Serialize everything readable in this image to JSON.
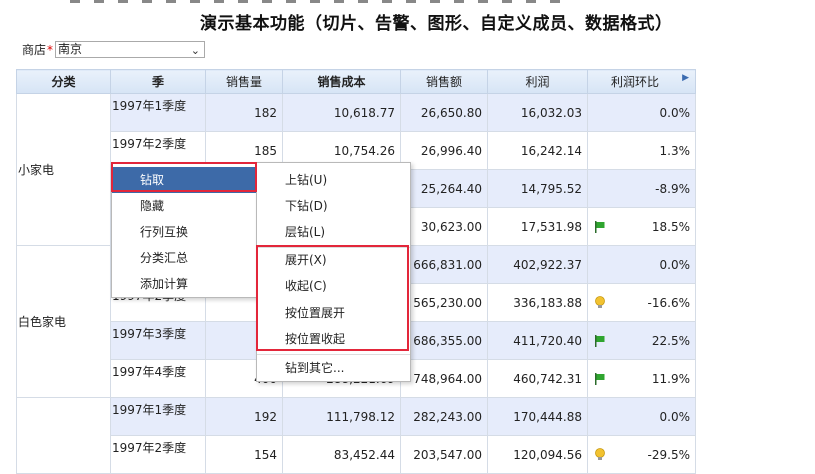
{
  "page": {
    "title": "演示基本功能（切片、告警、图形、自定义成员、数据格式）"
  },
  "filter": {
    "label": "商店",
    "required_mark": "*",
    "value": "南京"
  },
  "table": {
    "headers": [
      "分类",
      "季",
      "销售量",
      "销售成本",
      "销售额",
      "利润",
      "利润环比"
    ],
    "rows": [
      {
        "quarter": "1997年1季度",
        "sales_qty": "182",
        "cost": "10,618.77",
        "revenue": "26,650.80",
        "profit": "16,032.03",
        "ratio": "0.0%",
        "icon": ""
      },
      {
        "quarter": "1997年2季度",
        "sales_qty": "185",
        "cost": "10,754.26",
        "revenue": "26,996.40",
        "profit": "16,242.14",
        "ratio": "1.3%",
        "icon": ""
      },
      {
        "quarter": "",
        "sales_qty": "",
        "cost": "",
        "revenue": "25,264.40",
        "profit": "14,795.52",
        "ratio": "-8.9%",
        "icon": ""
      },
      {
        "quarter": "",
        "sales_qty": "",
        "cost": "",
        "revenue": "30,623.00",
        "profit": "17,531.98",
        "ratio": "18.5%",
        "icon": "flag"
      },
      {
        "quarter": "",
        "sales_qty": "",
        "cost": "",
        "revenue": "666,831.00",
        "profit": "402,922.37",
        "ratio": "0.0%",
        "icon": ""
      },
      {
        "quarter": "1997年2季度",
        "sales_qty": "",
        "cost": "",
        "revenue": "565,230.00",
        "profit": "336,183.88",
        "ratio": "-16.6%",
        "icon": "bulb"
      },
      {
        "quarter": "1997年3季度",
        "sales_qty": "",
        "cost": "",
        "revenue": "686,355.00",
        "profit": "411,720.40",
        "ratio": "22.5%",
        "icon": "flag"
      },
      {
        "quarter": "1997年4季度",
        "sales_qty": "400",
        "cost": "288,221.69",
        "revenue": "748,964.00",
        "profit": "460,742.31",
        "ratio": "11.9%",
        "icon": "flag"
      },
      {
        "quarter": "1997年1季度",
        "sales_qty": "192",
        "cost": "111,798.12",
        "revenue": "282,243.00",
        "profit": "170,444.88",
        "ratio": "0.0%",
        "icon": ""
      },
      {
        "quarter": "1997年2季度",
        "sales_qty": "154",
        "cost": "83,452.44",
        "revenue": "203,547.00",
        "profit": "120,094.56",
        "ratio": "-29.5%",
        "icon": "bulb"
      }
    ],
    "categories": [
      {
        "label": "小家电"
      },
      {
        "label": "白色家电"
      },
      {
        "label": ""
      }
    ]
  },
  "context_menu_left": {
    "items": [
      "钻取",
      "隐藏",
      "行列互换",
      "分类汇总",
      "添加计算"
    ]
  },
  "context_menu_right": {
    "items": [
      "上钻(U)",
      "下钻(D)",
      "层钻(L)",
      "展开(X)",
      "收起(C)",
      "按位置展开",
      "按位置收起",
      "钻到其它..."
    ]
  },
  "colors": {
    "menu_active": "#3d6aa8",
    "highlight_box": "#e3263a",
    "row_alt": "#e6ecfb",
    "flag": "#2fa52f",
    "bulb": "#f2c230"
  }
}
